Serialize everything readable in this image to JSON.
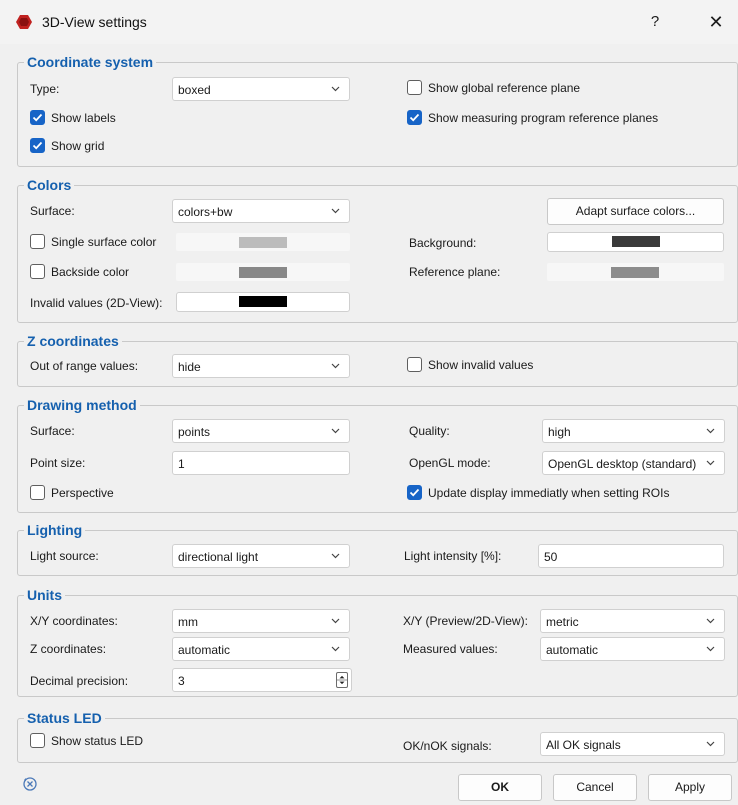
{
  "window": {
    "title": "3D-View settings",
    "help": "?",
    "close": "✕"
  },
  "coordinate_system": {
    "title": "Coordinate system",
    "type_label": "Type:",
    "type_value": "boxed",
    "show_global_ref": "Show global reference plane",
    "show_global_ref_checked": false,
    "show_labels": "Show labels",
    "show_labels_checked": true,
    "show_measuring_ref": "Show measuring program reference planes",
    "show_measuring_ref_checked": true,
    "show_grid": "Show grid",
    "show_grid_checked": true
  },
  "colors": {
    "title": "Colors",
    "surface_label": "Surface:",
    "surface_value": "colors+bw",
    "adapt_button": "Adapt surface colors...",
    "single_surface": "Single surface color",
    "single_surface_checked": false,
    "single_surface_color": "#bcbcbc",
    "background_label": "Background:",
    "background_color": "#3a3a3a",
    "backside": "Backside color",
    "backside_checked": false,
    "backside_color": "#888888",
    "reference_plane_label": "Reference plane:",
    "reference_plane_color": "#8c8c8c",
    "invalid_label": "Invalid values (2D-View):",
    "invalid_color": "#000000"
  },
  "z_coordinates": {
    "title": "Z coordinates",
    "out_of_range_label": "Out of range values:",
    "out_of_range_value": "hide",
    "show_invalid": "Show invalid values",
    "show_invalid_checked": false
  },
  "drawing": {
    "title": "Drawing method",
    "surface_label": "Surface:",
    "surface_value": "points",
    "quality_label": "Quality:",
    "quality_value": "high",
    "point_size_label": "Point size:",
    "point_size_value": "1",
    "opengl_label": "OpenGL mode:",
    "opengl_value": "OpenGL desktop (standard)",
    "perspective": "Perspective",
    "perspective_checked": false,
    "update_display": "Update display immediatly when setting ROIs",
    "update_display_checked": true
  },
  "lighting": {
    "title": "Lighting",
    "source_label": "Light source:",
    "source_value": "directional light",
    "intensity_label": "Light intensity [%]:",
    "intensity_value": "50"
  },
  "units": {
    "title": "Units",
    "xy_label": "X/Y coordinates:",
    "xy_value": "mm",
    "xy_preview_label": "X/Y (Preview/2D-View):",
    "xy_preview_value": "metric",
    "z_label": "Z coordinates:",
    "z_value": "automatic",
    "measured_label": "Measured values:",
    "measured_value": "automatic",
    "decimal_label": "Decimal precision:",
    "decimal_value": "3"
  },
  "status_led": {
    "title": "Status LED",
    "show_led": "Show status LED",
    "show_led_checked": false,
    "signals_label": "OK/nOK signals:",
    "signals_value": "All OK signals"
  },
  "footer": {
    "ok": "OK",
    "cancel": "Cancel",
    "apply": "Apply"
  },
  "colors_theme": {
    "accent": "#1764c7",
    "group_title": "#1560ae"
  }
}
